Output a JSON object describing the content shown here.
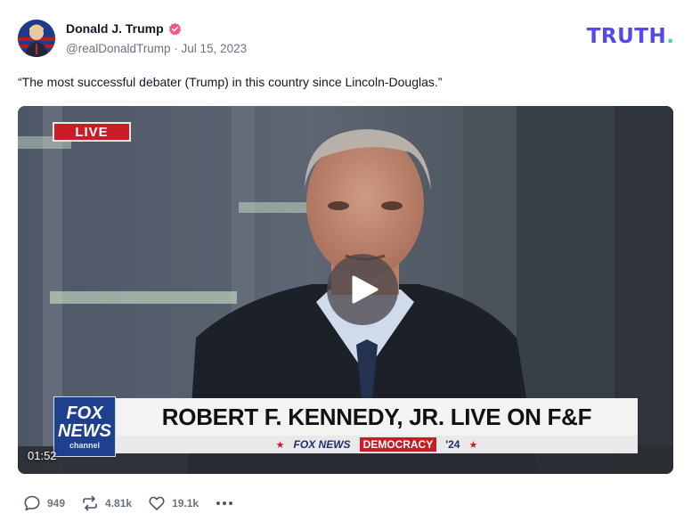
{
  "post": {
    "author_name": "Donald J. Trump",
    "handle": "@realDonaldTrump",
    "separator": "·",
    "date": "Jul 15, 2023",
    "text": "“The most successful debater (Trump) in this country since Lincoln-Douglas.”"
  },
  "brand": {
    "text": "TRUTH",
    "dot": ".",
    "color": "#5448ee",
    "dot_color": "#3ed3c5"
  },
  "video": {
    "live_label": "LIVE",
    "headline": "ROBERT F. KENNEDY, JR. LIVE ON F&F",
    "network_line": "FOX NEWS",
    "tag": "DEMOCRACY",
    "year": "'24",
    "channel_logo_line1": "FOX",
    "channel_logo_line2": "NEWS",
    "channel_logo_line3": "channel",
    "duration": "01:52"
  },
  "actions": {
    "replies": "949",
    "retruths": "4.81k",
    "likes": "19.1k"
  },
  "icons": {
    "verified": "verified-badge-icon",
    "reply": "speech-bubble-icon",
    "retruth": "repost-arrows-icon",
    "like": "heart-icon",
    "more": "ellipsis-icon",
    "play": "play-icon"
  },
  "colors": {
    "verified": "#f05a7e",
    "live_red": "#c81d25",
    "fox_blue": "#1f3f8f"
  }
}
